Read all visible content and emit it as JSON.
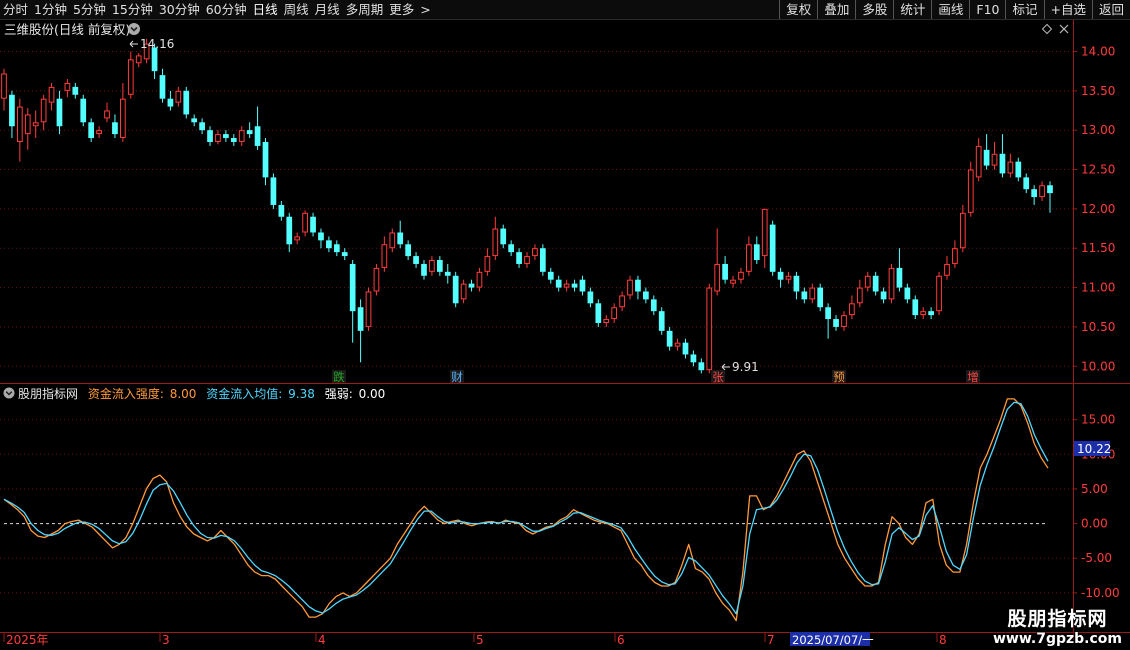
{
  "toolbar": {
    "periods": [
      "分时",
      "1分钟",
      "5分钟",
      "15分钟",
      "30分钟",
      "60分钟",
      "日线",
      "周线",
      "月线",
      "多周期",
      "更多"
    ],
    "more_chevron": ">",
    "active_period": "日线",
    "right_buttons": [
      "复权",
      "叠加",
      "多股",
      "统计",
      "画线",
      "F10",
      "标记",
      "+自选",
      "返回"
    ]
  },
  "main_panel": {
    "stock_title": "三维股份(日线 前复权)",
    "dropdown_icon": "chevron-down-icon",
    "diamond_icon": "diamond-icon",
    "close_icon": "close-icon",
    "high_label": "14.16",
    "low_label": "9.91",
    "y_ticks": [
      "14.00",
      "13.50",
      "13.00",
      "12.50",
      "12.00",
      "11.50",
      "11.00",
      "10.50",
      "10.00"
    ],
    "event_markers": [
      {
        "text": "跌",
        "color": "#22aa22"
      },
      {
        "text": "财",
        "color": "#5ab4ff"
      },
      {
        "text": "张",
        "color": "#ff4444"
      },
      {
        "text": "预",
        "color": "#ff9a3c"
      },
      {
        "text": "增",
        "color": "#ff4444"
      }
    ]
  },
  "indicator_panel": {
    "name": "股朋指标网",
    "strength_label": "资金流入强度:",
    "strength_value": "8.00",
    "avg_label": "资金流入均值:",
    "avg_value": "9.38",
    "weak_label": "强弱:",
    "weak_value": "0.00",
    "y_ticks": [
      "15.00",
      "10.00",
      "5.00",
      "0.00",
      "-5.00",
      "-10.00"
    ],
    "current_value_tag": "10.22",
    "colors": {
      "strength": "#ff9a3c",
      "average": "#4fd8ff",
      "zero_line": "#dddddd"
    }
  },
  "x_axis": {
    "labels": [
      "2025年",
      "3",
      "4",
      "5",
      "6",
      "7",
      "8"
    ],
    "highlight_date": "2025/07/07/一"
  },
  "watermark": {
    "line1": "股朋指标网",
    "line2": "www.7gpzb.com"
  },
  "chart_data": {
    "type": "candlestick",
    "up_color": "#ff3c3c",
    "down_color": "#54ffff",
    "ylim": [
      9.8,
      14.4
    ],
    "candles": [
      [
        13.4,
        13.72,
        13.78,
        13.25
      ],
      [
        13.45,
        13.05,
        13.5,
        12.9
      ],
      [
        12.85,
        13.3,
        13.4,
        12.6
      ],
      [
        12.95,
        13.2,
        13.28,
        12.75
      ],
      [
        13.05,
        13.1,
        13.25,
        12.9
      ],
      [
        13.1,
        13.4,
        13.45,
        13.0
      ],
      [
        13.35,
        13.55,
        13.6,
        13.25
      ],
      [
        13.4,
        13.05,
        13.5,
        12.95
      ],
      [
        13.5,
        13.6,
        13.65,
        13.42
      ],
      [
        13.55,
        13.45,
        13.6,
        13.4
      ],
      [
        13.4,
        13.1,
        13.45,
        13.05
      ],
      [
        13.1,
        12.9,
        13.15,
        12.85
      ],
      [
        12.95,
        13.0,
        13.05,
        12.9
      ],
      [
        13.15,
        13.25,
        13.35,
        13.1
      ],
      [
        13.1,
        12.95,
        13.2,
        12.9
      ],
      [
        12.9,
        13.4,
        13.6,
        12.85
      ],
      [
        13.45,
        13.9,
        14.0,
        13.4
      ],
      [
        13.85,
        13.95,
        13.98,
        13.8
      ],
      [
        13.9,
        14.1,
        14.16,
        13.85
      ],
      [
        14.05,
        13.75,
        14.1,
        13.65
      ],
      [
        13.7,
        13.4,
        13.78,
        13.35
      ],
      [
        13.4,
        13.3,
        13.5,
        13.25
      ],
      [
        13.35,
        13.5,
        13.55,
        13.3
      ],
      [
        13.5,
        13.2,
        13.55,
        13.15
      ],
      [
        13.15,
        13.1,
        13.2,
        13.05
      ],
      [
        13.1,
        13.0,
        13.15,
        12.95
      ],
      [
        13.0,
        12.85,
        13.05,
        12.8
      ],
      [
        12.85,
        12.95,
        13.0,
        12.82
      ],
      [
        12.95,
        12.9,
        13.0,
        12.85
      ],
      [
        12.9,
        12.85,
        12.95,
        12.8
      ],
      [
        12.85,
        13.0,
        13.05,
        12.8
      ],
      [
        13.0,
        12.95,
        13.1,
        12.9
      ],
      [
        13.05,
        12.8,
        13.3,
        12.75
      ],
      [
        12.85,
        12.4,
        12.9,
        12.3
      ],
      [
        12.4,
        12.05,
        12.45,
        12.0
      ],
      [
        12.05,
        11.9,
        12.1,
        11.85
      ],
      [
        11.9,
        11.55,
        11.95,
        11.45
      ],
      [
        11.6,
        11.65,
        11.7,
        11.55
      ],
      [
        11.7,
        11.95,
        11.98,
        11.65
      ],
      [
        11.9,
        11.7,
        11.95,
        11.65
      ],
      [
        11.7,
        11.6,
        11.75,
        11.5
      ],
      [
        11.6,
        11.5,
        11.65,
        11.45
      ],
      [
        11.55,
        11.45,
        11.6,
        11.4
      ],
      [
        11.45,
        11.4,
        11.5,
        11.35
      ],
      [
        11.3,
        10.7,
        11.35,
        10.3
      ],
      [
        10.75,
        10.45,
        10.85,
        10.05
      ],
      [
        10.5,
        10.95,
        11.0,
        10.45
      ],
      [
        10.95,
        11.25,
        11.3,
        10.9
      ],
      [
        11.25,
        11.55,
        11.65,
        11.2
      ],
      [
        11.5,
        11.7,
        11.75,
        11.45
      ],
      [
        11.7,
        11.55,
        11.85,
        11.5
      ],
      [
        11.55,
        11.4,
        11.6,
        11.35
      ],
      [
        11.4,
        11.3,
        11.45,
        11.25
      ],
      [
        11.3,
        11.15,
        11.35,
        11.1
      ],
      [
        11.2,
        11.35,
        11.4,
        11.15
      ],
      [
        11.35,
        11.2,
        11.4,
        11.15
      ],
      [
        11.2,
        11.15,
        11.3,
        11.05
      ],
      [
        11.15,
        10.8,
        11.2,
        10.75
      ],
      [
        10.85,
        11.05,
        11.1,
        10.8
      ],
      [
        11.05,
        11.0,
        11.1,
        10.95
      ],
      [
        11.0,
        11.2,
        11.25,
        10.95
      ],
      [
        11.2,
        11.4,
        11.5,
        11.15
      ],
      [
        11.4,
        11.75,
        11.9,
        11.35
      ],
      [
        11.75,
        11.55,
        11.8,
        11.5
      ],
      [
        11.55,
        11.45,
        11.6,
        11.4
      ],
      [
        11.45,
        11.3,
        11.5,
        11.25
      ],
      [
        11.3,
        11.4,
        11.45,
        11.25
      ],
      [
        11.4,
        11.5,
        11.55,
        11.35
      ],
      [
        11.5,
        11.2,
        11.55,
        11.15
      ],
      [
        11.2,
        11.1,
        11.25,
        11.05
      ],
      [
        11.1,
        11.0,
        11.15,
        10.95
      ],
      [
        11.0,
        11.05,
        11.1,
        10.95
      ],
      [
        11.05,
        11.0,
        11.1,
        10.95
      ],
      [
        11.1,
        10.95,
        11.15,
        10.9
      ],
      [
        10.95,
        10.8,
        11.0,
        10.75
      ],
      [
        10.8,
        10.55,
        10.85,
        10.5
      ],
      [
        10.55,
        10.6,
        10.65,
        10.5
      ],
      [
        10.6,
        10.75,
        10.8,
        10.55
      ],
      [
        10.75,
        10.9,
        10.95,
        10.7
      ],
      [
        10.9,
        11.1,
        11.15,
        10.85
      ],
      [
        11.1,
        10.95,
        11.15,
        10.85
      ],
      [
        10.95,
        10.85,
        11.0,
        10.8
      ],
      [
        10.85,
        10.7,
        10.9,
        10.65
      ],
      [
        10.7,
        10.45,
        10.75,
        10.4
      ],
      [
        10.45,
        10.25,
        10.5,
        10.2
      ],
      [
        10.25,
        10.3,
        10.35,
        10.2
      ],
      [
        10.3,
        10.15,
        10.35,
        10.1
      ],
      [
        10.15,
        10.05,
        10.2,
        10.0
      ],
      [
        10.05,
        9.95,
        10.1,
        9.91
      ],
      [
        9.95,
        11.0,
        11.05,
        9.91
      ],
      [
        10.95,
        11.3,
        11.75,
        10.9
      ],
      [
        11.3,
        11.1,
        11.4,
        11.05
      ],
      [
        11.05,
        11.1,
        11.15,
        11.0
      ],
      [
        11.1,
        11.2,
        11.25,
        11.05
      ],
      [
        11.2,
        11.55,
        11.65,
        11.15
      ],
      [
        11.55,
        11.35,
        11.65,
        11.3
      ],
      [
        11.4,
        12.0,
        12.0,
        11.25
      ],
      [
        11.8,
        11.2,
        11.85,
        11.15
      ],
      [
        11.2,
        11.1,
        11.25,
        11.0
      ],
      [
        11.1,
        11.15,
        11.2,
        11.05
      ],
      [
        11.15,
        10.95,
        11.2,
        10.85
      ],
      [
        10.95,
        10.85,
        11.0,
        10.8
      ],
      [
        10.85,
        11.0,
        11.05,
        10.8
      ],
      [
        11.0,
        10.75,
        11.05,
        10.7
      ],
      [
        10.75,
        10.6,
        10.8,
        10.35
      ],
      [
        10.6,
        10.5,
        10.65,
        10.45
      ],
      [
        10.5,
        10.65,
        10.7,
        10.45
      ],
      [
        10.65,
        10.8,
        10.9,
        10.6
      ],
      [
        10.8,
        11.0,
        11.1,
        10.75
      ],
      [
        11.0,
        11.15,
        11.2,
        10.95
      ],
      [
        11.15,
        10.95,
        11.2,
        10.9
      ],
      [
        10.95,
        10.85,
        11.0,
        10.8
      ],
      [
        10.85,
        11.25,
        11.3,
        10.8
      ],
      [
        11.25,
        11.0,
        11.5,
        10.95
      ],
      [
        11.0,
        10.85,
        11.05,
        10.8
      ],
      [
        10.85,
        10.65,
        10.9,
        10.6
      ],
      [
        10.65,
        10.7,
        10.75,
        10.6
      ],
      [
        10.7,
        10.65,
        10.75,
        10.6
      ],
      [
        10.7,
        11.15,
        11.2,
        10.65
      ],
      [
        11.15,
        11.3,
        11.4,
        11.1
      ],
      [
        11.3,
        11.5,
        11.6,
        11.25
      ],
      [
        11.5,
        11.95,
        12.05,
        11.45
      ],
      [
        11.95,
        12.5,
        12.6,
        11.9
      ],
      [
        12.4,
        12.8,
        12.9,
        12.35
      ],
      [
        12.75,
        12.55,
        12.95,
        12.5
      ],
      [
        12.55,
        12.7,
        12.85,
        12.5
      ],
      [
        12.7,
        12.45,
        12.95,
        12.4
      ],
      [
        12.45,
        12.6,
        12.7,
        12.4
      ],
      [
        12.6,
        12.4,
        12.65,
        12.35
      ],
      [
        12.4,
        12.25,
        12.45,
        12.2
      ],
      [
        12.25,
        12.15,
        12.3,
        12.05
      ],
      [
        12.15,
        12.3,
        12.35,
        12.1
      ],
      [
        12.3,
        12.2,
        12.35,
        11.95
      ]
    ],
    "indicator": {
      "ylim": [
        -15.5,
        20
      ],
      "strength": [
        3.5,
        2.8,
        2.0,
        1.0,
        -1.0,
        -1.8,
        -2.0,
        -1.5,
        -1.0,
        0.0,
        0.3,
        0.5,
        0.0,
        -0.5,
        -1.5,
        -2.5,
        -3.5,
        -3.0,
        -2.0,
        0.0,
        2.5,
        5.0,
        6.5,
        7.0,
        6.0,
        3.0,
        1.0,
        -0.5,
        -1.5,
        -2.0,
        -2.5,
        -2.0,
        -1.0,
        -2.0,
        -3.0,
        -4.5,
        -6.0,
        -7.0,
        -7.5,
        -7.5,
        -8.0,
        -9.0,
        -10.0,
        -11.0,
        -12.0,
        -13.5,
        -13.5,
        -13.0,
        -11.5,
        -10.5,
        -10.0,
        -10.5,
        -10.0,
        -9.0,
        -8.0,
        -7.0,
        -6.0,
        -5.0,
        -3.0,
        -1.5,
        0.0,
        1.5,
        2.5,
        1.5,
        0.5,
        0.0,
        0.3,
        0.5,
        0.0,
        -0.3,
        0.0,
        0.2,
        0.3,
        0.0,
        0.5,
        0.2,
        0.0,
        -1.0,
        -1.5,
        -1.0,
        -0.5,
        -0.3,
        0.5,
        1.0,
        2.0,
        1.5,
        1.0,
        0.5,
        0.2,
        0.0,
        -0.5,
        -1.0,
        -3.0,
        -5.0,
        -6.0,
        -7.5,
        -8.5,
        -9.0,
        -9.0,
        -8.5,
        -6.0,
        -3.0,
        -6.5,
        -7.0,
        -8.0,
        -10.0,
        -11.5,
        -12.5,
        -14.0,
        -7.0,
        4.0,
        4.0,
        2.0,
        2.5,
        4.0,
        6.0,
        8.0,
        10.0,
        10.5,
        9.0,
        6.0,
        3.0,
        0.0,
        -3.0,
        -5.0,
        -6.5,
        -8.0,
        -9.0,
        -9.0,
        -8.5,
        -3.0,
        1.0,
        0.0,
        -2.0,
        -3.0,
        -1.5,
        3.0,
        3.5,
        -3.0,
        -6.0,
        -7.0,
        -7.0,
        -3.0,
        3.0,
        8.0,
        10.0,
        12.5,
        15.0,
        18.0,
        18.0,
        17.0,
        14.5,
        11.5,
        9.5,
        8.0
      ],
      "average": [
        3.5,
        3.0,
        2.4,
        1.6,
        0.0,
        -1.0,
        -1.6,
        -1.7,
        -1.4,
        -0.7,
        -0.2,
        0.2,
        0.2,
        -0.1,
        -0.7,
        -1.6,
        -2.5,
        -2.9,
        -2.6,
        -1.4,
        0.5,
        2.8,
        4.8,
        5.6,
        5.8,
        4.7,
        3.0,
        1.2,
        -0.3,
        -1.4,
        -2.0,
        -2.1,
        -1.7,
        -1.9,
        -2.5,
        -3.6,
        -4.9,
        -6.0,
        -6.8,
        -7.1,
        -7.5,
        -8.2,
        -9.0,
        -10.0,
        -11.0,
        -12.0,
        -12.6,
        -12.9,
        -12.3,
        -11.5,
        -10.9,
        -10.6,
        -10.3,
        -9.6,
        -8.8,
        -7.8,
        -6.8,
        -5.8,
        -4.2,
        -2.6,
        -0.9,
        0.6,
        1.8,
        1.8,
        1.0,
        0.3,
        0.1,
        0.3,
        0.2,
        0.0,
        0.0,
        0.1,
        0.2,
        0.1,
        0.3,
        0.3,
        0.1,
        -0.5,
        -1.1,
        -1.1,
        -0.7,
        -0.4,
        0.2,
        0.7,
        1.5,
        1.6,
        1.2,
        0.8,
        0.4,
        0.1,
        -0.2,
        -0.6,
        -1.9,
        -3.6,
        -5.0,
        -6.4,
        -7.6,
        -8.4,
        -8.8,
        -8.7,
        -7.2,
        -4.9,
        -5.4,
        -6.4,
        -7.4,
        -8.9,
        -10.4,
        -11.6,
        -13.0,
        -9.0,
        -1.5,
        2.0,
        2.2,
        2.4,
        3.4,
        5.0,
        6.8,
        8.8,
        10.0,
        9.8,
        7.8,
        4.9,
        1.8,
        -1.2,
        -3.6,
        -5.5,
        -7.1,
        -8.3,
        -8.8,
        -8.7,
        -5.5,
        -1.5,
        -0.6,
        -1.4,
        -2.3,
        -1.8,
        1.2,
        2.6,
        -0.5,
        -4.0,
        -6.0,
        -6.6,
        -4.5,
        0.8,
        5.5,
        8.5,
        11.0,
        13.8,
        16.5,
        17.5,
        17.3,
        15.5,
        12.8,
        10.8,
        9.0
      ]
    }
  }
}
